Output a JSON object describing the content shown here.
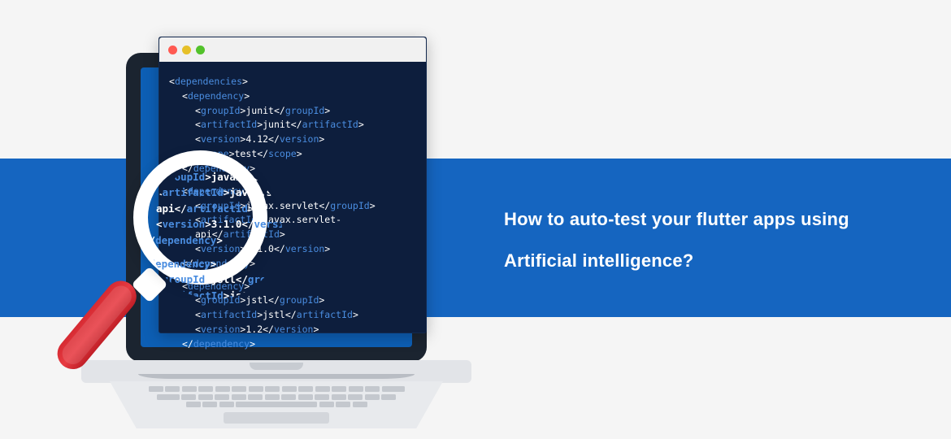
{
  "headline": {
    "line1": "How to auto-test your flutter apps using",
    "line2": "Artificial intelligence?"
  },
  "colors": {
    "band": "#1565c0",
    "codeBg": "#0d1e3d",
    "handle": "#d62a32"
  },
  "traffic_lights": [
    "red",
    "yellow",
    "green"
  ],
  "code": {
    "blocks": [
      {
        "wrapper": "dependencies",
        "deps": [
          {
            "groupId": "junit",
            "artifactId": "junit",
            "version": "4.12",
            "scope": "test"
          },
          {
            "groupId": "javax.servlet",
            "artifactId": "javax.servlet-api",
            "version": "3.1.0"
          },
          {
            "groupId": "jstl",
            "artifactId": "jstl",
            "version": "1.2"
          }
        ]
      }
    ]
  },
  "code_lines": [
    {
      "indent": 0,
      "parts": [
        {
          "t": "br",
          "v": "<"
        },
        {
          "t": "tag",
          "v": "dependencies"
        },
        {
          "t": "br",
          "v": ">"
        }
      ]
    },
    {
      "indent": 1,
      "parts": [
        {
          "t": "br",
          "v": "<"
        },
        {
          "t": "tag",
          "v": "dependency"
        },
        {
          "t": "br",
          "v": ">"
        }
      ]
    },
    {
      "indent": 2,
      "parts": [
        {
          "t": "br",
          "v": "<"
        },
        {
          "t": "tag",
          "v": "groupId"
        },
        {
          "t": "br",
          "v": ">"
        },
        {
          "t": "val",
          "v": "junit"
        },
        {
          "t": "br",
          "v": "</"
        },
        {
          "t": "tag",
          "v": "groupId"
        },
        {
          "t": "br",
          "v": ">"
        }
      ]
    },
    {
      "indent": 2,
      "parts": [
        {
          "t": "br",
          "v": "<"
        },
        {
          "t": "tag",
          "v": "artifactId"
        },
        {
          "t": "br",
          "v": ">"
        },
        {
          "t": "val",
          "v": "junit"
        },
        {
          "t": "br",
          "v": "</"
        },
        {
          "t": "tag",
          "v": "artifactId"
        },
        {
          "t": "br",
          "v": ">"
        }
      ]
    },
    {
      "indent": 2,
      "parts": [
        {
          "t": "br",
          "v": "<"
        },
        {
          "t": "tag",
          "v": "version"
        },
        {
          "t": "br",
          "v": ">"
        },
        {
          "t": "val",
          "v": "4.12"
        },
        {
          "t": "br",
          "v": "</"
        },
        {
          "t": "tag",
          "v": "version"
        },
        {
          "t": "br",
          "v": ">"
        }
      ]
    },
    {
      "indent": 2,
      "parts": [
        {
          "t": "br",
          "v": "<"
        },
        {
          "t": "tag",
          "v": "scope"
        },
        {
          "t": "br",
          "v": ">"
        },
        {
          "t": "val",
          "v": "test"
        },
        {
          "t": "br",
          "v": "</"
        },
        {
          "t": "tag",
          "v": "scope"
        },
        {
          "t": "br",
          "v": ">"
        }
      ]
    },
    {
      "indent": 1,
      "parts": [
        {
          "t": "br",
          "v": "</"
        },
        {
          "t": "tag",
          "v": "dependency"
        },
        {
          "t": "br",
          "v": ">"
        }
      ]
    },
    {
      "indent": -1,
      "parts": []
    },
    {
      "indent": 1,
      "parts": [
        {
          "t": "br",
          "v": "<"
        },
        {
          "t": "tag",
          "v": "dependency"
        },
        {
          "t": "br",
          "v": ">"
        }
      ]
    },
    {
      "indent": 2,
      "parts": [
        {
          "t": "br",
          "v": "<"
        },
        {
          "t": "tag",
          "v": "groupId"
        },
        {
          "t": "br",
          "v": ">"
        },
        {
          "t": "val",
          "v": "javax.servlet"
        },
        {
          "t": "br",
          "v": "</"
        },
        {
          "t": "tag",
          "v": "groupId"
        },
        {
          "t": "br",
          "v": ">"
        }
      ]
    },
    {
      "indent": 2,
      "parts": [
        {
          "t": "br",
          "v": "<"
        },
        {
          "t": "tag",
          "v": "artifactId"
        },
        {
          "t": "br",
          "v": ">"
        },
        {
          "t": "val",
          "v": "javax.servlet-api"
        },
        {
          "t": "br",
          "v": "</"
        },
        {
          "t": "tag",
          "v": "artifactId"
        },
        {
          "t": "br",
          "v": ">"
        }
      ]
    },
    {
      "indent": 2,
      "parts": [
        {
          "t": "br",
          "v": "<"
        },
        {
          "t": "tag",
          "v": "version"
        },
        {
          "t": "br",
          "v": ">"
        },
        {
          "t": "val",
          "v": "3.1.0"
        },
        {
          "t": "br",
          "v": "</"
        },
        {
          "t": "tag",
          "v": "version"
        },
        {
          "t": "br",
          "v": ">"
        }
      ]
    },
    {
      "indent": 1,
      "parts": [
        {
          "t": "br",
          "v": "</"
        },
        {
          "t": "tag",
          "v": "dependency"
        },
        {
          "t": "br",
          "v": ">"
        }
      ]
    },
    {
      "indent": -1,
      "parts": []
    },
    {
      "indent": 1,
      "parts": [
        {
          "t": "br",
          "v": "<"
        },
        {
          "t": "tag",
          "v": "dependency"
        },
        {
          "t": "br",
          "v": ">"
        }
      ]
    },
    {
      "indent": 2,
      "parts": [
        {
          "t": "br",
          "v": "<"
        },
        {
          "t": "tag",
          "v": "groupId"
        },
        {
          "t": "br",
          "v": ">"
        },
        {
          "t": "val",
          "v": "jstl"
        },
        {
          "t": "br",
          "v": "</"
        },
        {
          "t": "tag",
          "v": "groupId"
        },
        {
          "t": "br",
          "v": ">"
        }
      ]
    },
    {
      "indent": 2,
      "parts": [
        {
          "t": "br",
          "v": "<"
        },
        {
          "t": "tag",
          "v": "artifactId"
        },
        {
          "t": "br",
          "v": ">"
        },
        {
          "t": "val",
          "v": "jstl"
        },
        {
          "t": "br",
          "v": "</"
        },
        {
          "t": "tag",
          "v": "artifactId"
        },
        {
          "t": "br",
          "v": ">"
        }
      ]
    },
    {
      "indent": 2,
      "parts": [
        {
          "t": "br",
          "v": "<"
        },
        {
          "t": "tag",
          "v": "version"
        },
        {
          "t": "br",
          "v": ">"
        },
        {
          "t": "val",
          "v": "1.2"
        },
        {
          "t": "br",
          "v": "</"
        },
        {
          "t": "tag",
          "v": "version"
        },
        {
          "t": "br",
          "v": ">"
        }
      ]
    },
    {
      "indent": 1,
      "parts": [
        {
          "t": "br",
          "v": "</"
        },
        {
          "t": "tag",
          "v": "dependency"
        },
        {
          "t": "br",
          "v": ">"
        }
      ]
    }
  ]
}
